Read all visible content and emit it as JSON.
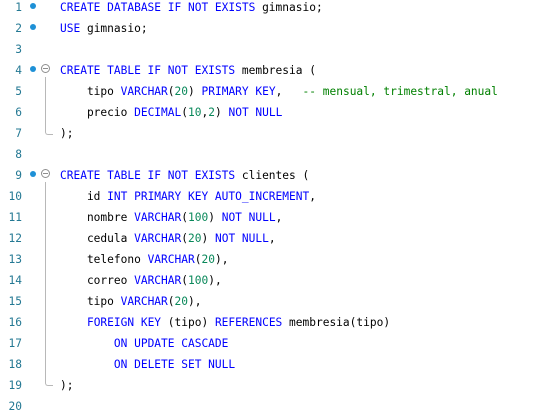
{
  "editor": {
    "lines": [
      {
        "n": "1",
        "tokens": [
          [
            "k",
            "CREATE DATABASE IF NOT EXISTS"
          ],
          [
            "t",
            " gimnasio;"
          ]
        ]
      },
      {
        "n": "2",
        "tokens": [
          [
            "k",
            "USE"
          ],
          [
            "t",
            " gimnasio;"
          ]
        ]
      },
      {
        "n": "3",
        "tokens": []
      },
      {
        "n": "4",
        "tokens": [
          [
            "k",
            "CREATE TABLE IF NOT EXISTS"
          ],
          [
            "t",
            " membresia ("
          ]
        ]
      },
      {
        "n": "5",
        "tokens": [
          [
            "t",
            "    tipo "
          ],
          [
            "k",
            "VARCHAR"
          ],
          [
            "t",
            "("
          ],
          [
            "n",
            "20"
          ],
          [
            "t",
            ") "
          ],
          [
            "k",
            "PRIMARY KEY"
          ],
          [
            "t",
            ",   "
          ],
          [
            "c",
            "-- mensual, trimestral, anual"
          ]
        ]
      },
      {
        "n": "6",
        "tokens": [
          [
            "t",
            "    precio "
          ],
          [
            "k",
            "DECIMAL"
          ],
          [
            "t",
            "("
          ],
          [
            "n",
            "10"
          ],
          [
            "t",
            ","
          ],
          [
            "n",
            "2"
          ],
          [
            "t",
            ") "
          ],
          [
            "k",
            "NOT NULL"
          ]
        ]
      },
      {
        "n": "7",
        "tokens": [
          [
            "t",
            ");"
          ]
        ]
      },
      {
        "n": "8",
        "tokens": []
      },
      {
        "n": "9",
        "tokens": [
          [
            "k",
            "CREATE TABLE IF NOT EXISTS"
          ],
          [
            "t",
            " clientes ("
          ]
        ]
      },
      {
        "n": "10",
        "tokens": [
          [
            "t",
            "    id "
          ],
          [
            "k",
            "INT PRIMARY KEY AUTO_INCREMENT"
          ],
          [
            "t",
            ","
          ]
        ]
      },
      {
        "n": "11",
        "tokens": [
          [
            "t",
            "    nombre "
          ],
          [
            "k",
            "VARCHAR"
          ],
          [
            "t",
            "("
          ],
          [
            "n",
            "100"
          ],
          [
            "t",
            ") "
          ],
          [
            "k",
            "NOT NULL"
          ],
          [
            "t",
            ","
          ]
        ]
      },
      {
        "n": "12",
        "tokens": [
          [
            "t",
            "    cedula "
          ],
          [
            "k",
            "VARCHAR"
          ],
          [
            "t",
            "("
          ],
          [
            "n",
            "20"
          ],
          [
            "t",
            ") "
          ],
          [
            "k",
            "NOT NULL"
          ],
          [
            "t",
            ","
          ]
        ]
      },
      {
        "n": "13",
        "tokens": [
          [
            "t",
            "    telefono "
          ],
          [
            "k",
            "VARCHAR"
          ],
          [
            "t",
            "("
          ],
          [
            "n",
            "20"
          ],
          [
            "t",
            "),"
          ]
        ]
      },
      {
        "n": "14",
        "tokens": [
          [
            "t",
            "    correo "
          ],
          [
            "k",
            "VARCHAR"
          ],
          [
            "t",
            "("
          ],
          [
            "n",
            "100"
          ],
          [
            "t",
            "),"
          ]
        ]
      },
      {
        "n": "15",
        "tokens": [
          [
            "t",
            "    tipo "
          ],
          [
            "k",
            "VARCHAR"
          ],
          [
            "t",
            "("
          ],
          [
            "n",
            "20"
          ],
          [
            "t",
            "),"
          ]
        ]
      },
      {
        "n": "16",
        "tokens": [
          [
            "t",
            "    "
          ],
          [
            "k",
            "FOREIGN KEY"
          ],
          [
            "t",
            " (tipo) "
          ],
          [
            "k",
            "REFERENCES"
          ],
          [
            "t",
            " membresia(tipo)"
          ]
        ]
      },
      {
        "n": "17",
        "tokens": [
          [
            "t",
            "        "
          ],
          [
            "k",
            "ON UPDATE CASCADE"
          ]
        ]
      },
      {
        "n": "18",
        "tokens": [
          [
            "t",
            "        "
          ],
          [
            "k",
            "ON DELETE SET NULL"
          ]
        ]
      },
      {
        "n": "19",
        "tokens": [
          [
            "t",
            ");"
          ]
        ]
      },
      {
        "n": "20",
        "tokens": []
      }
    ],
    "breakpoint_lines": [
      "1",
      "2",
      "4",
      "9"
    ],
    "fold_lines": [
      "4",
      "9"
    ],
    "colors": {
      "keyword": "#0000ff",
      "number": "#09885a",
      "comment": "#008000",
      "line_number": "#237893",
      "breakpoint": "#1e90d6"
    }
  }
}
